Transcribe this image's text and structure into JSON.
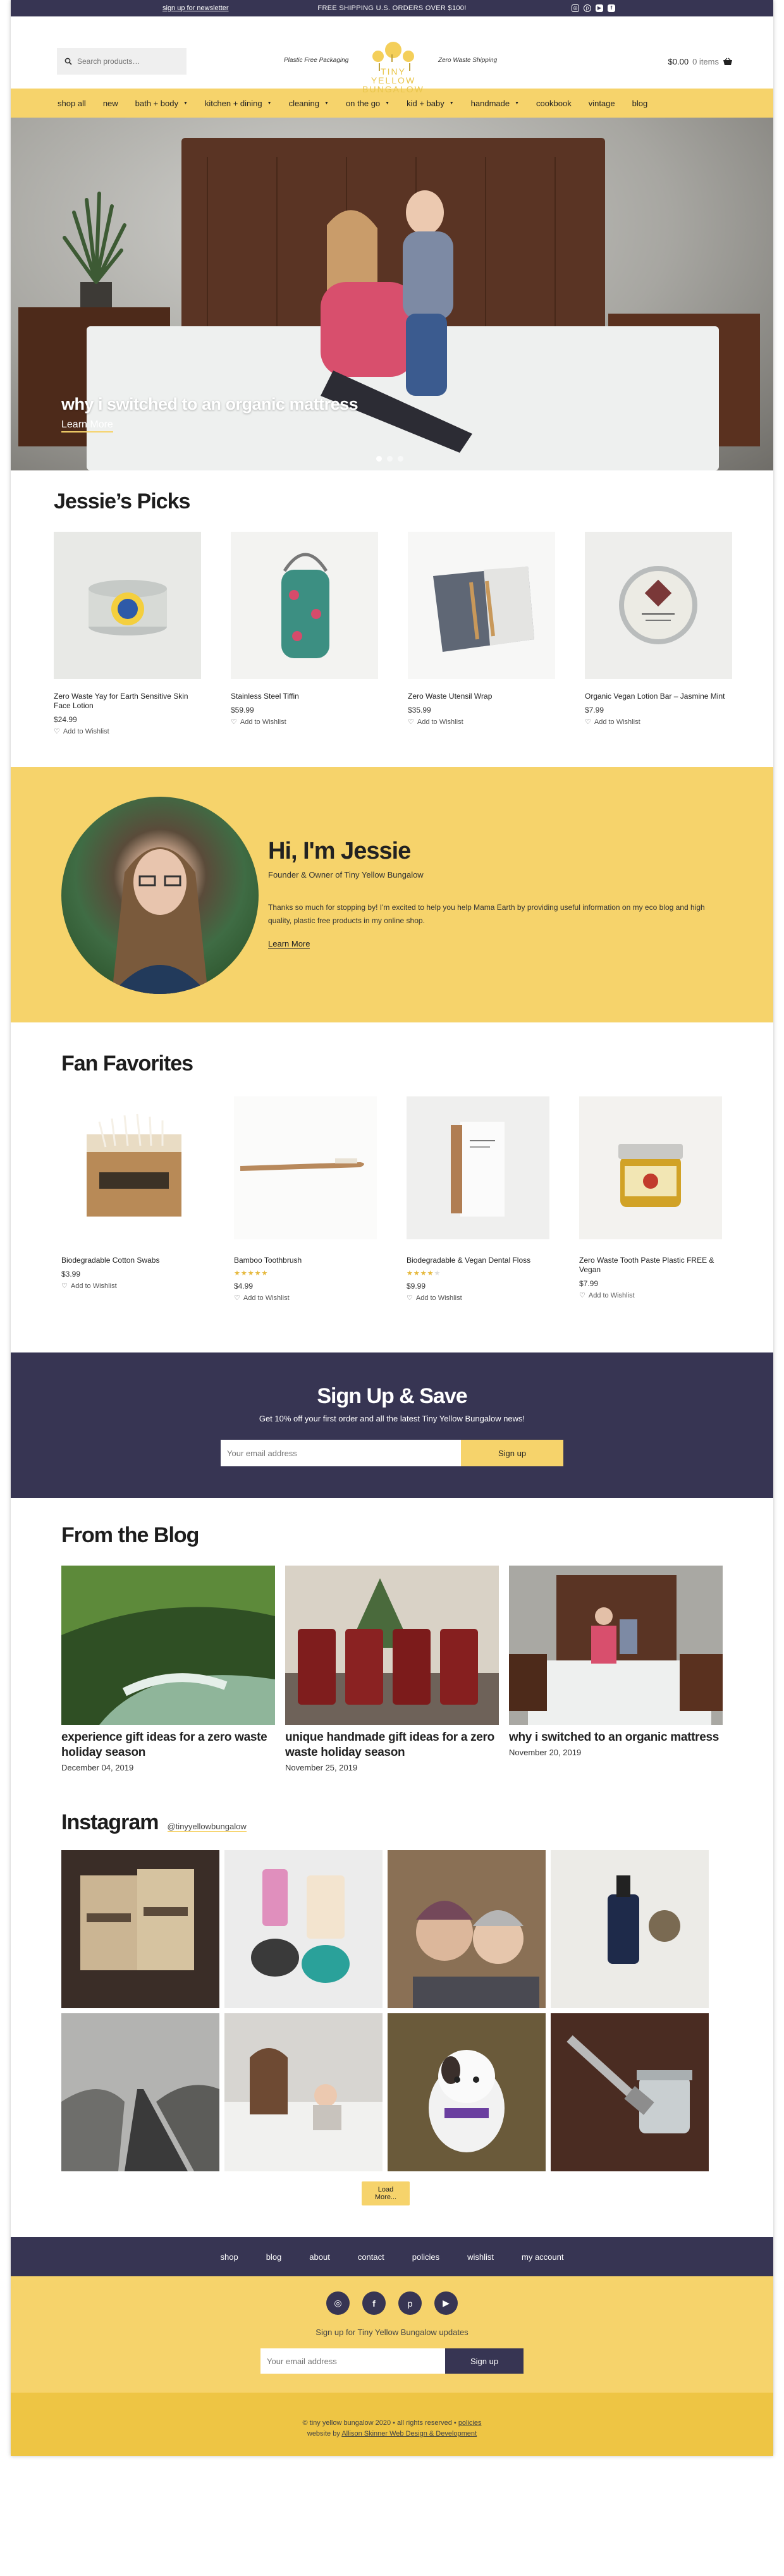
{
  "topbar": {
    "newsletter": "sign up for newsletter",
    "shipping": "FREE SHIPPING U.S. ORDERS OVER $100!",
    "social": [
      "instagram-icon",
      "pinterest-icon",
      "youtube-icon",
      "facebook-icon"
    ]
  },
  "header": {
    "search_placeholder": "Search products…",
    "tag_left": "Plastic Free Packaging",
    "tag_right": "Zero Waste Shipping",
    "logo_line1": "TINY YELLOW",
    "logo_line2": "BUNGALOW",
    "cart_total": "$0.00",
    "cart_items": "0 items"
  },
  "nav": [
    {
      "label": "shop all",
      "caret": false
    },
    {
      "label": "new",
      "caret": false
    },
    {
      "label": "bath + body",
      "caret": true
    },
    {
      "label": "kitchen + dining",
      "caret": true
    },
    {
      "label": "cleaning",
      "caret": true
    },
    {
      "label": "on the go",
      "caret": true
    },
    {
      "label": "kid + baby",
      "caret": true
    },
    {
      "label": "handmade",
      "caret": true
    },
    {
      "label": "cookbook",
      "caret": false
    },
    {
      "label": "vintage",
      "caret": false
    },
    {
      "label": "blog",
      "caret": false
    }
  ],
  "hero": {
    "title": "why i switched to an organic mattress",
    "link": "Learn More",
    "active_slide": 1,
    "slides": 3
  },
  "picks": {
    "title": "Jessie’s Picks",
    "items": [
      {
        "name": "Zero Waste Yay for Earth Sensitive Skin Face Lotion",
        "price": "$24.99",
        "wish": "Add to Wishlist"
      },
      {
        "name": "Stainless Steel Tiffin",
        "price": "$59.99",
        "wish": "Add to Wishlist"
      },
      {
        "name": "Zero Waste Utensil Wrap",
        "price": "$35.99",
        "wish": "Add to Wishlist"
      },
      {
        "name": "Organic Vegan Lotion Bar – Jasmine Mint",
        "price": "$7.99",
        "wish": "Add to Wishlist"
      }
    ]
  },
  "about": {
    "title": "Hi, I'm Jessie",
    "role": "Founder & Owner of Tiny Yellow Bungalow",
    "intro": "Thanks so much for stopping by! I'm excited to help you help Mama Earth by providing useful information on my eco blog and high quality, plastic free products in my online shop.",
    "more": "Learn More"
  },
  "fans": {
    "title": "Fan Favorites",
    "items": [
      {
        "name": "Biodegradable Cotton Swabs",
        "price": "$3.99",
        "rating": 0,
        "wish": "Add to Wishlist"
      },
      {
        "name": "Bamboo Toothbrush",
        "price": "$4.99",
        "rating": 5,
        "wish": "Add to Wishlist"
      },
      {
        "name": "Biodegradable & Vegan Dental Floss",
        "price": "$9.99",
        "rating": 4,
        "wish": "Add to Wishlist"
      },
      {
        "name": "Zero Waste Tooth Paste Plastic FREE & Vegan",
        "price": "$7.99",
        "rating": 0,
        "wish": "Add to Wishlist"
      }
    ]
  },
  "signup": {
    "title": "Sign Up & Save",
    "subtitle": "Get 10% off your first order and all the latest Tiny Yellow Bungalow news!",
    "placeholder": "Your email address",
    "button": "Sign up"
  },
  "blog": {
    "title": "From the Blog",
    "posts": [
      {
        "title": "experience gift ideas for a zero waste holiday season",
        "date": "December 04, 2019"
      },
      {
        "title": "unique handmade gift ideas for a zero waste holiday season",
        "date": "November 25, 2019"
      },
      {
        "title": "why i switched to an organic mattress",
        "date": "November 20, 2019"
      }
    ]
  },
  "instagram": {
    "title": "Instagram",
    "handle": "@tinyyellowbungalow",
    "load_more": "Load More..."
  },
  "footer": {
    "nav": [
      "shop",
      "blog",
      "about",
      "contact",
      "policies",
      "wishlist",
      "my account"
    ],
    "social": [
      "instagram-icon",
      "facebook-icon",
      "pinterest-icon",
      "youtube-icon"
    ],
    "signup_text": "Sign up for Tiny Yellow Bungalow updates",
    "placeholder": "Your email address",
    "button": "Sign up",
    "copyright": "© tiny yellow bungalow 2020 • all rights reserved •",
    "policies": "policies",
    "credit_prefix": "website by",
    "credit": "Allison Skinner Web Design & Development"
  },
  "colors": {
    "navy": "#373553",
    "yellow": "#f6d36b",
    "gold": "#eec544"
  }
}
